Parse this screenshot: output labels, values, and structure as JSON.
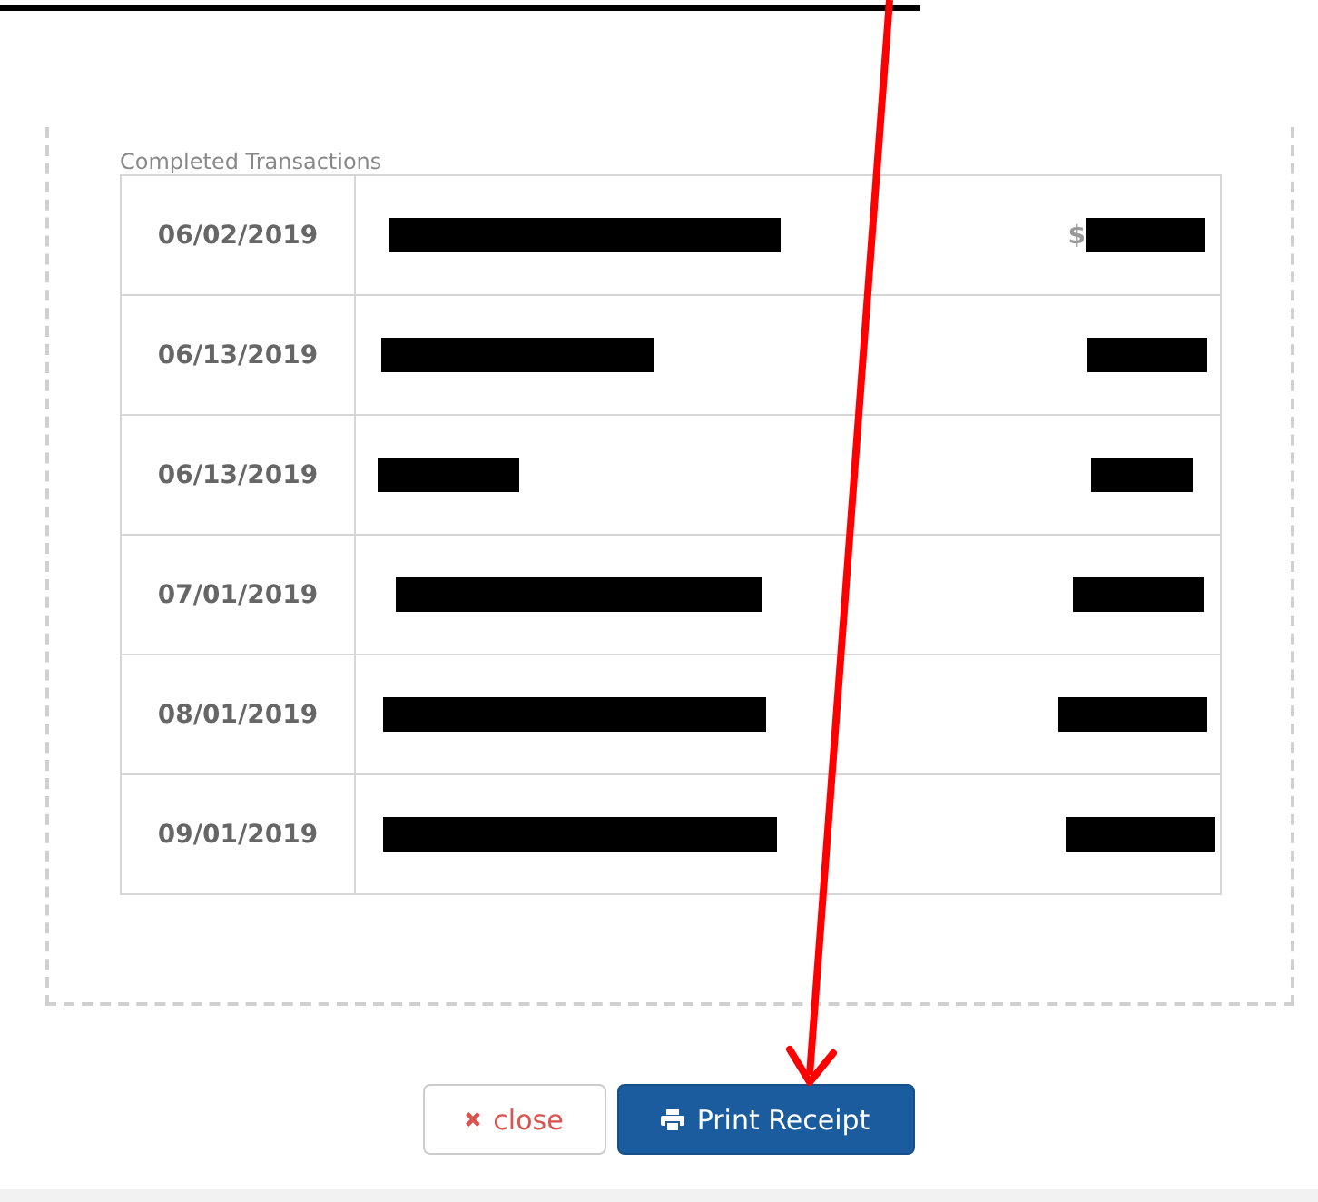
{
  "table": {
    "caption": "Completed Transactions",
    "rows": [
      {
        "date": "06/02/2019",
        "amount_prefix": "$"
      },
      {
        "date": "06/13/2019"
      },
      {
        "date": "06/13/2019"
      },
      {
        "date": "07/01/2019"
      },
      {
        "date": "08/01/2019"
      },
      {
        "date": "09/01/2019"
      }
    ]
  },
  "buttons": [
    {
      "kind": "close",
      "label": "close"
    },
    {
      "kind": "print",
      "label": "Print Receipt"
    }
  ]
}
